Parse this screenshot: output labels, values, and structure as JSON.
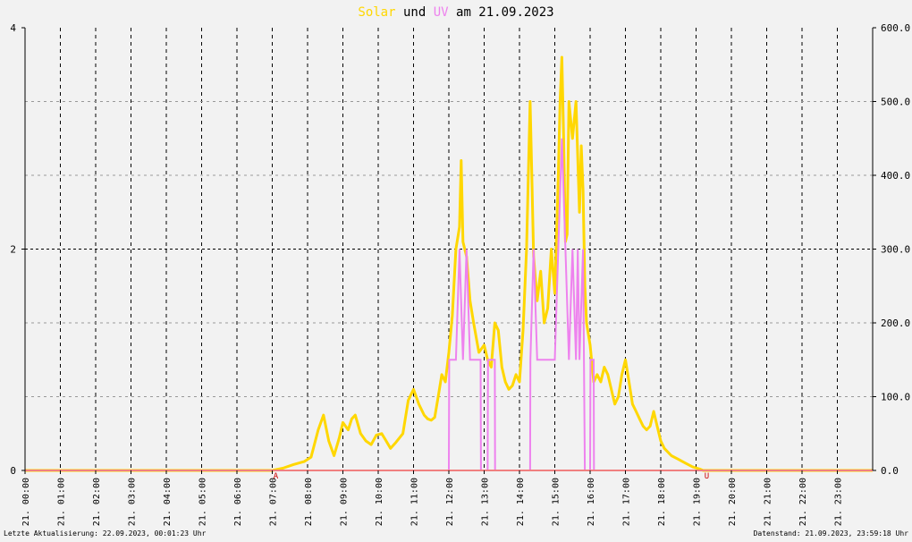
{
  "title": {
    "solar": "Solar",
    "und": "und",
    "uv": "UV",
    "rest": "am 21.09.2023"
  },
  "colors": {
    "solar": "#ffd700",
    "uv": "#ee82ee",
    "zero_line": "#f08080",
    "background": "#f2f2f2",
    "grid": "#000000",
    "marker": "#cc0000"
  },
  "footer": {
    "left": "Letzte Aktualisierung: 22.09.2023, 00:01:23 Uhr",
    "right": "Datenstand: 21.09.2023, 23:59:18 Uhr"
  },
  "chart_data": {
    "type": "line",
    "x_unit": "hour of day",
    "xlim": [
      0,
      24
    ],
    "x_tick_labels": [
      "21. 00:00",
      "21. 01:00",
      "21. 02:00",
      "21. 03:00",
      "21. 04:00",
      "21. 05:00",
      "21. 06:00",
      "21. 07:00",
      "21. 08:00",
      "21. 09:00",
      "21. 10:00",
      "21. 11:00",
      "21. 12:00",
      "21. 13:00",
      "21. 14:00",
      "21. 15:00",
      "21. 16:00",
      "21. 17:00",
      "21. 18:00",
      "21. 19:00",
      "21. 20:00",
      "21. 21:00",
      "21. 22:00",
      "21. 23:00"
    ],
    "y_left": {
      "ylim": [
        0,
        4
      ],
      "tick_labels": [
        "0",
        "2",
        "4"
      ]
    },
    "y_right": {
      "ylim": [
        0,
        600
      ],
      "tick_labels": [
        "0.0",
        "100.0",
        "200.0",
        "300.0",
        "400.0",
        "500.0",
        "600.0"
      ]
    },
    "grid": true,
    "markers": [
      {
        "label": "A",
        "x": 7.0
      },
      {
        "label": "U",
        "x": 19.2
      }
    ],
    "series": [
      {
        "name": "Solar",
        "axis": "right",
        "x": [
          0,
          7.0,
          7.3,
          7.6,
          7.9,
          8.1,
          8.3,
          8.45,
          8.6,
          8.75,
          8.9,
          9.0,
          9.15,
          9.25,
          9.35,
          9.5,
          9.65,
          9.8,
          9.95,
          10.1,
          10.2,
          10.35,
          10.5,
          10.7,
          10.85,
          11.0,
          11.15,
          11.3,
          11.4,
          11.5,
          11.6,
          11.7,
          11.8,
          11.9,
          12.0,
          12.1,
          12.2,
          12.3,
          12.35,
          12.4,
          12.5,
          12.6,
          12.7,
          12.85,
          13.0,
          13.1,
          13.2,
          13.3,
          13.4,
          13.5,
          13.6,
          13.7,
          13.8,
          13.9,
          14.0,
          14.1,
          14.2,
          14.3,
          14.35,
          14.4,
          14.5,
          14.6,
          14.7,
          14.8,
          14.9,
          15.0,
          15.1,
          15.15,
          15.2,
          15.25,
          15.3,
          15.35,
          15.4,
          15.5,
          15.6,
          15.7,
          15.75,
          15.8,
          15.85,
          15.9,
          16.0,
          16.1,
          16.2,
          16.3,
          16.4,
          16.5,
          16.6,
          16.7,
          16.8,
          16.9,
          17.0,
          17.1,
          17.2,
          17.3,
          17.4,
          17.5,
          17.6,
          17.7,
          17.8,
          17.9,
          18.0,
          18.1,
          18.2,
          18.3,
          18.5,
          18.7,
          18.9,
          19.1,
          19.2,
          24
        ],
        "values": [
          0,
          0,
          3,
          8,
          12,
          18,
          55,
          75,
          40,
          20,
          45,
          65,
          55,
          70,
          75,
          50,
          40,
          35,
          48,
          50,
          42,
          30,
          38,
          50,
          95,
          110,
          90,
          75,
          70,
          68,
          72,
          100,
          130,
          120,
          160,
          210,
          300,
          330,
          420,
          310,
          290,
          230,
          200,
          160,
          170,
          150,
          140,
          200,
          190,
          140,
          120,
          110,
          115,
          130,
          120,
          190,
          300,
          500,
          400,
          290,
          230,
          270,
          200,
          220,
          300,
          240,
          400,
          500,
          560,
          450,
          310,
          320,
          500,
          450,
          500,
          350,
          440,
          380,
          250,
          200,
          170,
          120,
          130,
          120,
          140,
          130,
          110,
          90,
          100,
          130,
          150,
          120,
          90,
          80,
          70,
          60,
          55,
          60,
          80,
          60,
          40,
          30,
          25,
          20,
          15,
          10,
          5,
          2,
          0,
          0
        ]
      },
      {
        "name": "UV",
        "axis": "left",
        "x": [
          0,
          12.0,
          12.01,
          12.2,
          12.3,
          12.4,
          12.5,
          12.6,
          12.7,
          12.8,
          12.9,
          12.91,
          13.1,
          13.11,
          13.3,
          13.31,
          14.3,
          14.31,
          14.4,
          14.5,
          14.6,
          14.7,
          14.75,
          14.8,
          15.0,
          15.1,
          15.2,
          15.3,
          15.4,
          15.5,
          15.6,
          15.65,
          15.7,
          15.8,
          15.85,
          16.0,
          16.01,
          16.1,
          16.11,
          24
        ],
        "values": [
          0,
          0,
          1,
          1,
          2,
          1,
          2,
          1,
          1,
          1,
          1,
          0,
          0,
          1,
          1,
          0,
          0,
          1,
          2,
          1,
          1,
          1,
          1,
          1,
          1,
          2,
          3,
          2,
          1,
          2,
          1,
          2,
          1,
          2,
          0,
          0,
          1,
          1,
          0,
          0
        ]
      }
    ]
  }
}
